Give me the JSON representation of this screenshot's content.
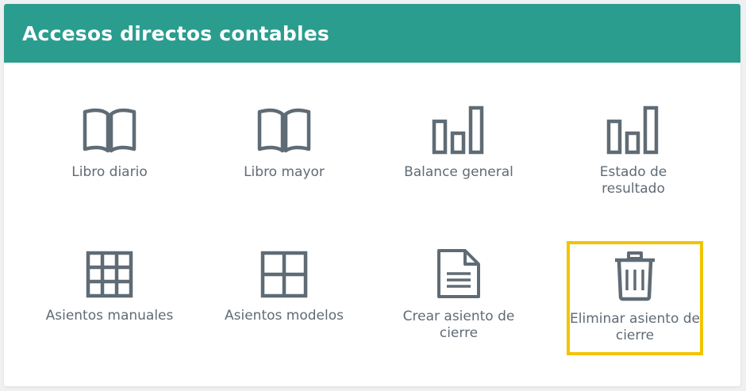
{
  "header": {
    "title": "Accesos directos contables"
  },
  "colors": {
    "header_bg": "#2a9d8f",
    "icon": "#5f6b75",
    "highlight": "#f2c400"
  },
  "shortcuts": [
    {
      "label": "Libro diario",
      "icon": "book-open-icon"
    },
    {
      "label": "Libro mayor",
      "icon": "book-open-icon"
    },
    {
      "label": "Balance general",
      "icon": "bar-chart-icon"
    },
    {
      "label": "Estado de resultado",
      "icon": "bar-chart-icon"
    },
    {
      "label": "Asientos manuales",
      "icon": "grid-3x3-icon"
    },
    {
      "label": "Asientos modelos",
      "icon": "grid-2x2-icon"
    },
    {
      "label": "Crear asiento de cierre",
      "icon": "document-icon"
    },
    {
      "label": "Eliminar asiento de cierre",
      "icon": "trash-icon",
      "highlighted": true
    }
  ]
}
